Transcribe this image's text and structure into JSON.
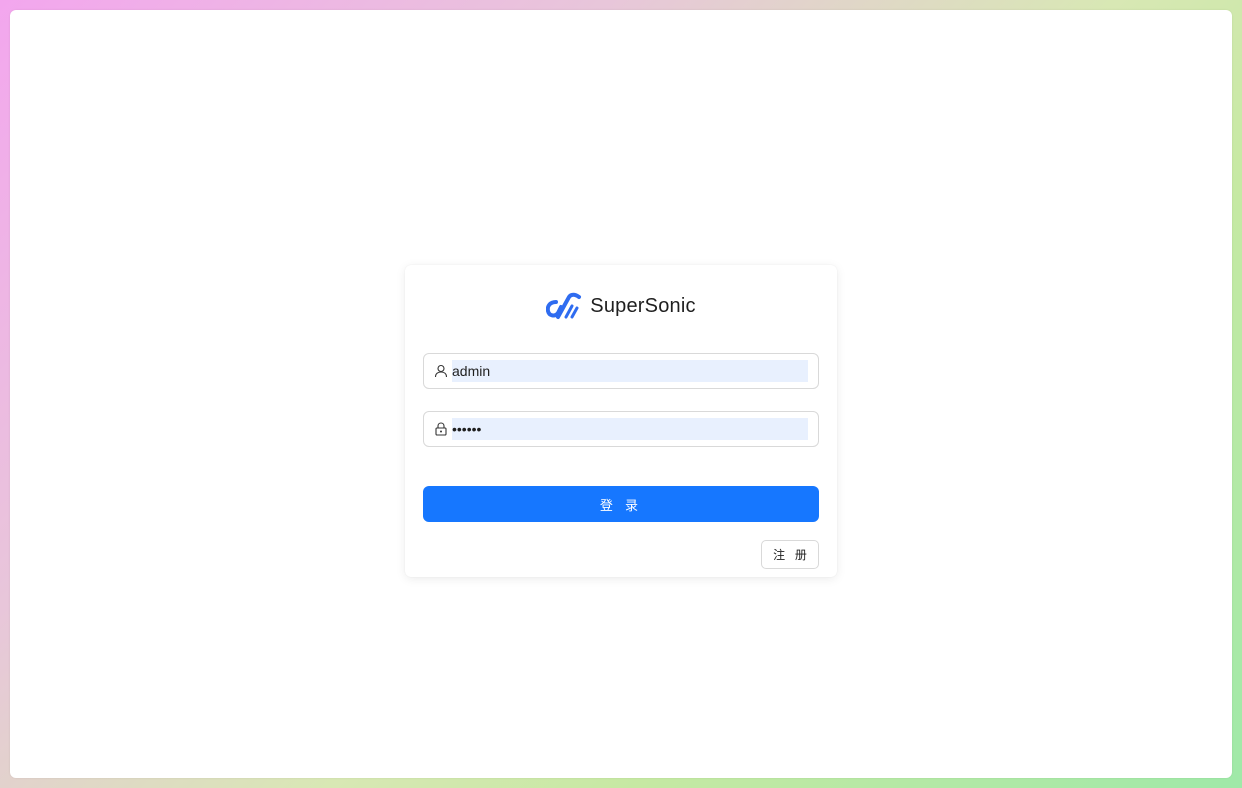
{
  "app": {
    "brand_name": "SuperSonic",
    "logo_icon": "supersonic-logo-icon"
  },
  "login_form": {
    "username": {
      "icon": "user-icon",
      "value": "admin"
    },
    "password": {
      "icon": "lock-icon",
      "value": "••••••"
    },
    "login_label": "登 录",
    "register_label": "注 册"
  },
  "colors": {
    "primary": "#1677ff",
    "autofill_bg": "#e8f0fe",
    "logo_blue": "#2f6cf0"
  }
}
